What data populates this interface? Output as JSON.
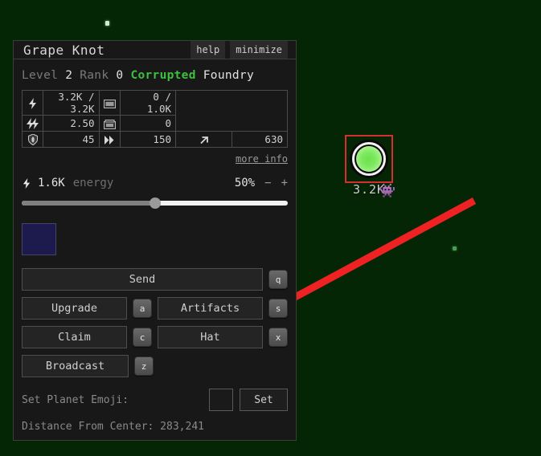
{
  "window": {
    "title": "Grape Knot",
    "help_label": "help",
    "minimize_label": "minimize"
  },
  "headline": {
    "level_label": "Level",
    "level_value": "2",
    "rank_label": "Rank",
    "rank_value": "0",
    "status": "Corrupted",
    "type": "Foundry",
    "status_color": "#3fbf3f"
  },
  "stats": {
    "rows": [
      {
        "left": {
          "icon": "energy-bolt-icon",
          "glyph": "⚡",
          "value": "3.2K / 3.2K"
        },
        "right": {
          "icon": "silver-bank-icon",
          "glyph": "💵",
          "value": "0 / 1.0K"
        }
      },
      {
        "left": {
          "icon": "energy-growth-icon",
          "glyph": "⚡⚡",
          "value": "2.50"
        },
        "right": {
          "icon": "artifact-box-icon",
          "glyph": "🗄",
          "value": "0"
        }
      }
    ],
    "bottom": [
      {
        "icon": "shield-icon",
        "glyph": "🛡",
        "value": "45"
      },
      {
        "icon": "speed-icon",
        "glyph": "»",
        "value": "150"
      },
      {
        "icon": "range-arrow-icon",
        "glyph": "↗",
        "value": "630"
      }
    ],
    "more_info_label": "more info"
  },
  "energy": {
    "bolt_icon": "energy-bolt-icon",
    "amount": "1.6K",
    "label": "energy",
    "percent": "50%",
    "percent_value": 50,
    "minus_label": "−",
    "plus_label": "+"
  },
  "swatch": {
    "color": "#1d1a4e"
  },
  "actions": {
    "rows": [
      [
        {
          "label": "Send",
          "key": "q",
          "style": "wide"
        }
      ],
      [
        {
          "label": "Upgrade",
          "key": "a",
          "style": "half"
        },
        {
          "label": "Artifacts",
          "key": "s",
          "style": "half"
        }
      ],
      [
        {
          "label": "Claim",
          "key": "c",
          "style": "half"
        },
        {
          "label": "Hat",
          "key": "x",
          "style": "half"
        }
      ],
      [
        {
          "label": "Broadcast",
          "key": "z",
          "style": "half"
        }
      ]
    ]
  },
  "footer": {
    "emoji_label": "Set Planet Emoji:",
    "emoji_value": "",
    "set_label": "Set",
    "distance_text": "Distance From Center: 283,241"
  },
  "planet": {
    "level_text": "3.2K",
    "emoji": "👾",
    "selected": true,
    "selection_color": "#d62f2f",
    "surface_color": "#7ae85c"
  },
  "background": {
    "color": "#052605",
    "arrow_color": "#ee2222"
  }
}
